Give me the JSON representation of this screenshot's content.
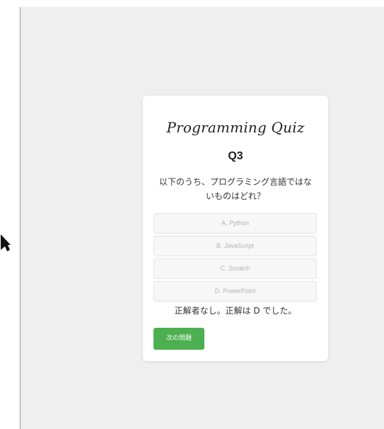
{
  "quiz": {
    "title": "Programming Quiz",
    "question_number": "Q3",
    "question_text": "以下のうち、プログラミング言語ではないものはどれ？",
    "options": [
      {
        "label": "A. Python"
      },
      {
        "label": "B. JavaScript"
      },
      {
        "label": "C. Scratch"
      },
      {
        "label": "D. PowerPoint"
      }
    ],
    "result_text": "正解者なし。正解は D でした。",
    "next_button_label": "次の問題"
  },
  "colors": {
    "page_background": "#efefef",
    "card_background": "#ffffff",
    "option_background": "#f7f7f7",
    "option_text": "#b3b3b3",
    "next_button": "#4caf50",
    "cursor": "#111111"
  }
}
